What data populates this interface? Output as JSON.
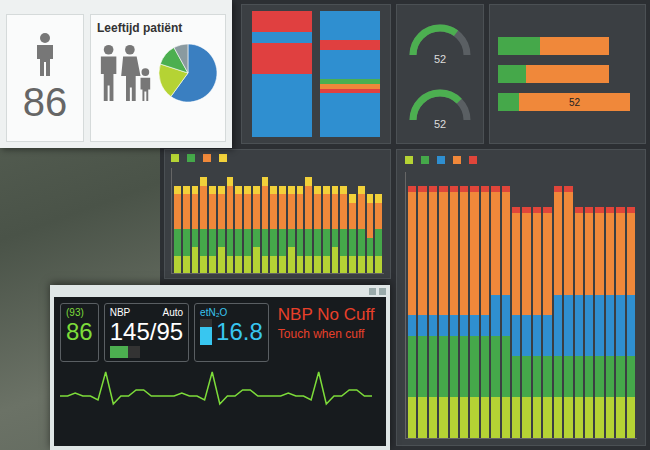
{
  "patient_card": {
    "value": "86"
  },
  "age_card": {
    "title": "Leeftijd patiënt",
    "pie": [
      {
        "value": 0.6,
        "color": "#3a7fc1"
      },
      {
        "value": 0.2,
        "color": "#b5d334"
      },
      {
        "value": 0.12,
        "color": "#4caf50"
      },
      {
        "value": 0.08,
        "color": "#8a9aa0"
      }
    ]
  },
  "dashboard": {
    "heat_columns": [
      {
        "segments": [
          {
            "color": "#e04040",
            "value": 2
          },
          {
            "color": "#2f8fd0",
            "value": 1
          },
          {
            "color": "#e04040",
            "value": 3
          },
          {
            "color": "#2f8fd0",
            "value": 6
          }
        ]
      },
      {
        "segments": [
          {
            "color": "#2f8fd0",
            "value": 3
          },
          {
            "color": "#e04040",
            "value": 1
          },
          {
            "color": "#2f8fd0",
            "value": 3
          },
          {
            "color": "#4caf50",
            "value": 0.5
          },
          {
            "color": "#f0883a",
            "value": 0.5
          },
          {
            "color": "#e04040",
            "value": 0.5
          },
          {
            "color": "#2f8fd0",
            "value": 4.5
          }
        ]
      }
    ],
    "gauges": [
      {
        "reading": "52",
        "level": 0.7
      },
      {
        "reading": "52",
        "level": 0.75
      }
    ],
    "hbar_chart": {
      "max": 10,
      "bar_label": "52",
      "series": [
        {
          "color": "#45a84a",
          "values": [
            3,
            2,
            1.5
          ]
        },
        {
          "color": "#f0883a",
          "values": [
            5,
            6,
            8
          ]
        }
      ]
    },
    "small_chart": {
      "max": 12,
      "series": [
        {
          "color": "#b5d334",
          "values": [
            2,
            2,
            3,
            2,
            2,
            3,
            2,
            2,
            2,
            3,
            2,
            2,
            2,
            3,
            2,
            2,
            2,
            2,
            3,
            2,
            2,
            2,
            2,
            2
          ]
        },
        {
          "color": "#45a84a",
          "values": [
            3,
            3,
            2,
            3,
            3,
            2,
            3,
            3,
            3,
            2,
            3,
            3,
            3,
            2,
            3,
            3,
            3,
            3,
            2,
            3,
            3,
            3,
            2,
            3
          ]
        },
        {
          "color": "#f0883a",
          "values": [
            4,
            4,
            4,
            5,
            4,
            4,
            5,
            4,
            4,
            4,
            5,
            4,
            4,
            4,
            4,
            5,
            4,
            4,
            4,
            4,
            3,
            4,
            4,
            3
          ]
        },
        {
          "color": "#f2d13a",
          "values": [
            1,
            1,
            1,
            1,
            1,
            1,
            1,
            1,
            1,
            1,
            1,
            1,
            1,
            1,
            1,
            1,
            1,
            1,
            1,
            1,
            1,
            1,
            1,
            1
          ]
        }
      ]
    },
    "big_chart": {
      "max": 13,
      "series": [
        {
          "color": "#b5d334",
          "values": [
            2,
            2,
            2,
            2,
            2,
            2,
            2,
            2,
            2,
            2,
            2,
            2,
            2,
            2,
            2,
            2,
            2,
            2,
            2,
            2,
            2,
            2
          ]
        },
        {
          "color": "#45a84a",
          "values": [
            3,
            3,
            3,
            3,
            3,
            3,
            3,
            3,
            3,
            3,
            2,
            2,
            2,
            2,
            2,
            2,
            2,
            2,
            2,
            2,
            2,
            2
          ]
        },
        {
          "color": "#2f8fd0",
          "values": [
            1,
            1,
            1,
            1,
            1,
            1,
            1,
            1,
            2,
            2,
            2,
            2,
            2,
            2,
            3,
            3,
            3,
            3,
            3,
            3,
            3,
            3
          ]
        },
        {
          "color": "#f0883a",
          "values": [
            6,
            6,
            6,
            6,
            6,
            6,
            6,
            6,
            5,
            5,
            5,
            5,
            5,
            5,
            5,
            5,
            4,
            4,
            4,
            4,
            4,
            4
          ]
        },
        {
          "color": "#e0453a",
          "values": [
            0.3,
            0.3,
            0.3,
            0.3,
            0.3,
            0.3,
            0.3,
            0.3,
            0.3,
            0.3,
            0.3,
            0.3,
            0.3,
            0.3,
            0.3,
            0.3,
            0.3,
            0.3,
            0.3,
            0.3,
            0.3,
            0.3
          ]
        }
      ]
    }
  },
  "monitor": {
    "vitals": [
      {
        "kind": "hr",
        "label": "(93)",
        "value": "86",
        "color": "#7ddc3a"
      },
      {
        "kind": "nbp",
        "label": "NBP",
        "mode": "Auto",
        "value": "145/95",
        "level": 0.6,
        "color": "#ffffff"
      },
      {
        "kind": "gas",
        "label": "etN₂O",
        "value": "16.8",
        "level": 0.7,
        "color": "#38c6f0"
      }
    ],
    "alarm": {
      "title": "NBP No Cuff",
      "message": "Touch when cuff"
    },
    "ecg": [
      0,
      0,
      0.15,
      0,
      0,
      -0.2,
      1.2,
      -0.4,
      0,
      0,
      0.3,
      0.3,
      0,
      0,
      0,
      0,
      0.15,
      0,
      0,
      -0.2,
      1.2,
      -0.4,
      0,
      0,
      0.3,
      0.3,
      0,
      0,
      0,
      0,
      0.15,
      0,
      0,
      -0.2,
      1.2,
      -0.4,
      0,
      0,
      0.3,
      0.3,
      0,
      0
    ]
  }
}
